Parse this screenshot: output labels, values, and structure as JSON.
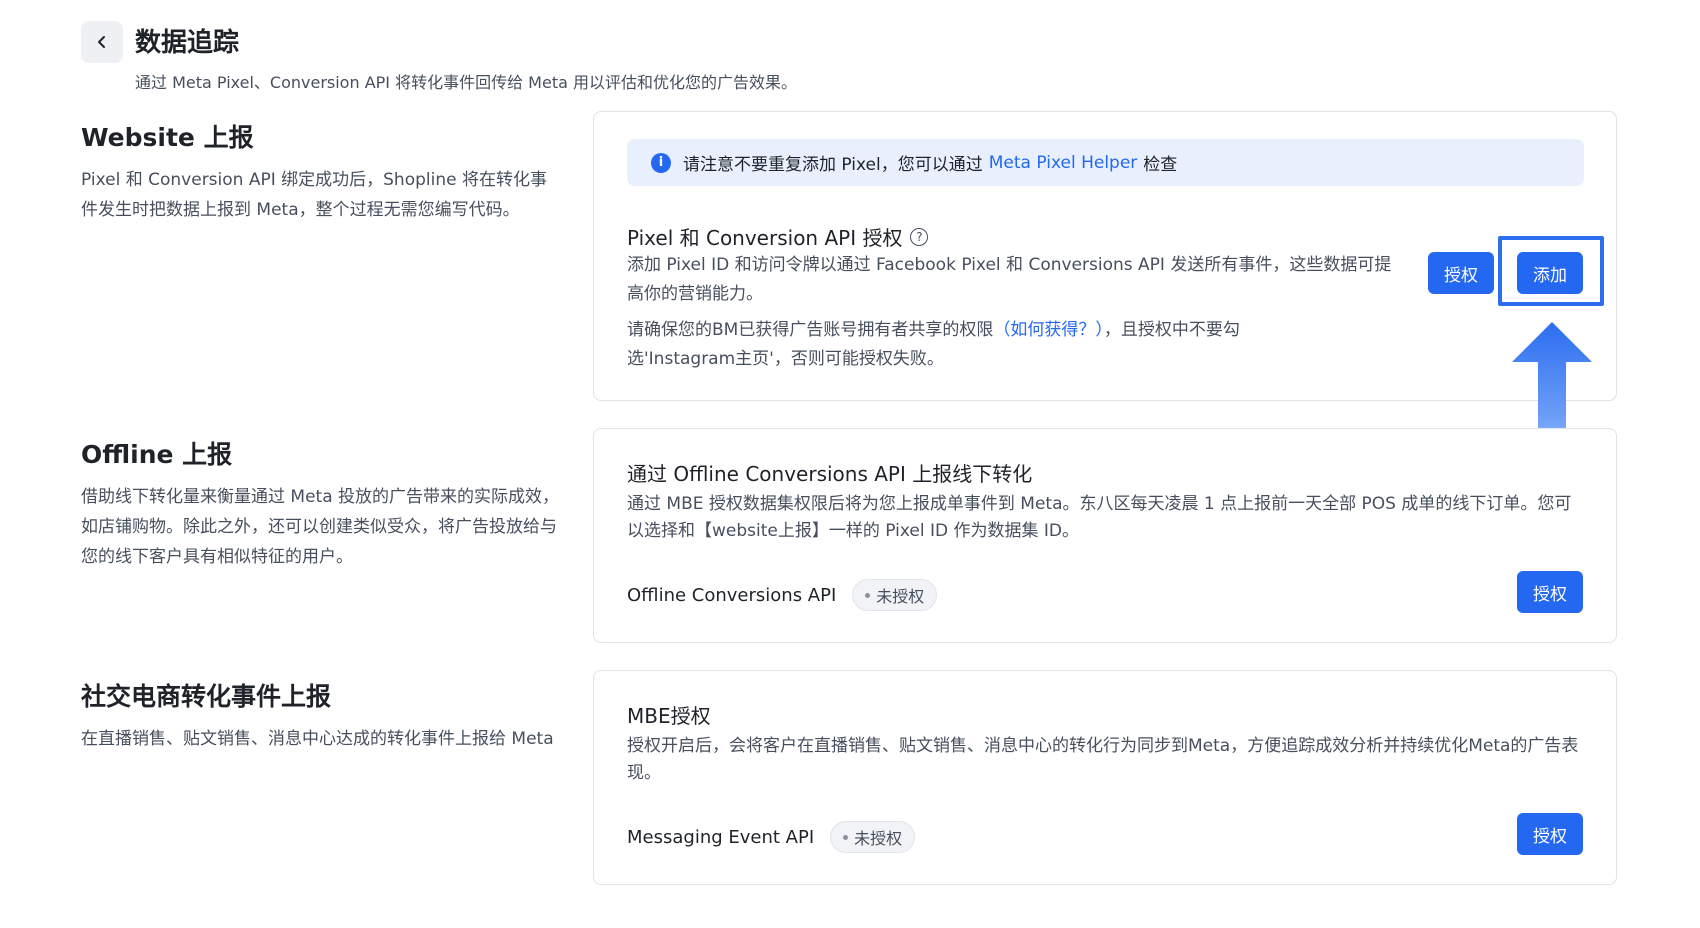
{
  "header": {
    "back_icon": "chevron-left-icon",
    "title": "数据追踪",
    "subtitle": "通过 Meta Pixel、Conversion API 将转化事件回传给 Meta 用以评估和优化您的广告效果。"
  },
  "sections": {
    "website": {
      "heading": "Website 上报",
      "desc": "Pixel 和 Conversion API 绑定成功后，Shopline 将在转化事件发生时把数据上报到 Meta，整个过程无需您编写代码。"
    },
    "offline": {
      "heading": "Offline 上报",
      "desc": "借助线下转化量来衡量通过 Meta 投放的广告带来的实际成效，如店铺购物。除此之外，还可以创建类似受众，将广告投放给与您的线下客户具有相似特征的用户。"
    },
    "social": {
      "heading": "社交电商转化事件上报",
      "desc": "在直播销售、贴文销售、消息中心达成的转化事件上报给 Meta"
    }
  },
  "website_card": {
    "notice_prefix": "请注意不要重复添加 Pixel，您可以通过 ",
    "notice_link": "Meta Pixel Helper",
    "notice_suffix": " 检查",
    "title": "Pixel 和 Conversion API 授权",
    "desc": "添加 Pixel ID 和访问令牌以通过 Facebook Pixel 和 Conversions API 发送所有事件，这些数据可提高你的营销能力。",
    "note_prefix": "请确保您的BM已获得广告账号拥有者共享的权限",
    "note_link": "（如何获得？）",
    "note_suffix": "，且授权中不要勾选'Instagram主页'，否则可能授权失败。",
    "authorize_label": "授权",
    "add_label": "添加"
  },
  "offline_card": {
    "title": "通过 Offline Conversions API 上报线下转化",
    "desc": "通过 MBE 授权数据集权限后将为您上报成单事件到 Meta。东八区每天凌晨 1 点上报前一天全部 POS 成单的线下订单。您可以选择和【website上报】一样的 Pixel ID 作为数据集 ID。",
    "api_name": "Offline Conversions API",
    "status": "未授权",
    "authorize_label": "授权"
  },
  "mbe_card": {
    "title": "MBE授权",
    "desc": "授权开启后，会将客户在直播销售、贴文销售、消息中心的转化行为同步到Meta，方便追踪成效分析并持续优化Meta的广告表现。",
    "api_name": "Messaging Event API",
    "status": "未授权",
    "authorize_label": "授权"
  },
  "colors": {
    "primary": "#2468f2",
    "highlight": "#2b6ef0",
    "notice_bg": "#e8f0fe"
  }
}
